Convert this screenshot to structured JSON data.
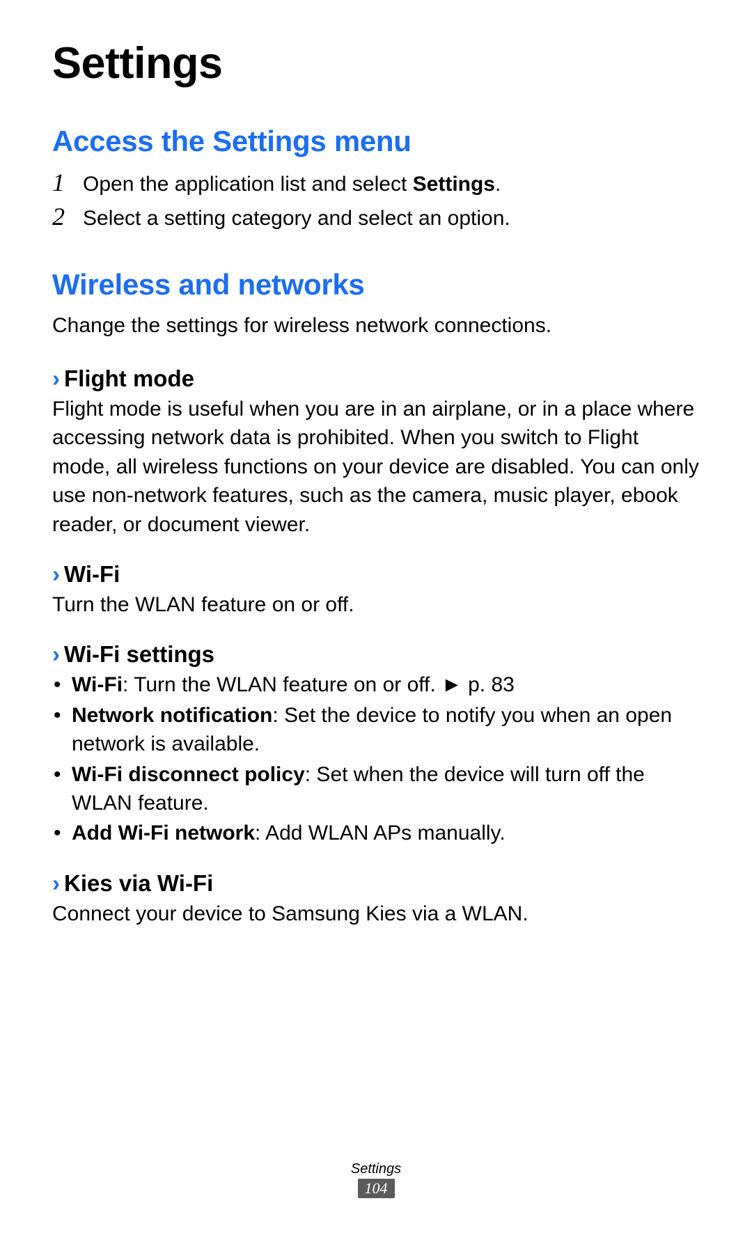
{
  "title": "Settings",
  "sections": [
    {
      "heading": "Access the Settings menu",
      "steps": [
        {
          "num": "1",
          "before": "Open the application list and select ",
          "bold": "Settings",
          "after": "."
        },
        {
          "num": "2",
          "before": "Select a setting category and select an option.",
          "bold": "",
          "after": ""
        }
      ]
    },
    {
      "heading": "Wireless and networks",
      "desc": "Change the settings for wireless network connections.",
      "subsections": [
        {
          "title": "Flight mode",
          "body": "Flight mode is useful when you are in an airplane, or in a place where accessing network data is prohibited. When you switch to Flight mode, all wireless functions on your device are disabled. You can only use non-network features, such as the camera, music player, ebook reader, or document viewer."
        },
        {
          "title": "Wi-Fi",
          "body": "Turn the WLAN feature on or off."
        },
        {
          "title": "Wi-Fi settings",
          "bullets": [
            {
              "bold": "Wi-Fi",
              "rest": ": Turn the WLAN feature on or off. ► p. 83"
            },
            {
              "bold": "Network notification",
              "rest": ": Set the device to notify you when an open network is available."
            },
            {
              "bold": "Wi-Fi disconnect policy",
              "rest": ": Set when the device will turn off the WLAN feature."
            },
            {
              "bold": "Add Wi-Fi network",
              "rest": ": Add WLAN APs manually."
            }
          ]
        },
        {
          "title": "Kies via Wi-Fi",
          "body": "Connect your device to Samsung Kies via a WLAN."
        }
      ]
    }
  ],
  "footer": {
    "label": "Settings",
    "page": "104"
  },
  "chevron": "›",
  "bullet": "•"
}
